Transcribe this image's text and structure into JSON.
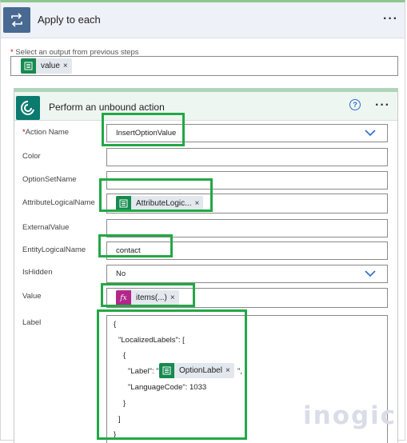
{
  "loop": {
    "title": "Apply to each",
    "more_label": "···",
    "select_label": "Select an output from previous steps",
    "required_mark": "*",
    "token": {
      "label": "value",
      "remove": "×",
      "icon": "dynamics-content-icon"
    }
  },
  "action": {
    "title": "Perform an unbound action",
    "help_label": "?",
    "more_label": "···",
    "required_mark": "*",
    "fields": {
      "action_name": {
        "label": "Action Name",
        "value": "InsertOptionValue"
      },
      "color": {
        "label": "Color",
        "value": ""
      },
      "option_set_name": {
        "label": "OptionSetName",
        "value": ""
      },
      "attribute_logical_name": {
        "label": "AttributeLogicalName",
        "token": "AttributeLogic...",
        "remove": "×"
      },
      "external_value": {
        "label": "ExternalValue",
        "value": ""
      },
      "entity_logical_name": {
        "label": "EntityLogicalName",
        "value": "contact"
      },
      "is_hidden": {
        "label": "IsHidden",
        "value": "No"
      },
      "value": {
        "label": "Value",
        "token": "items(...)",
        "icon_text": "fx",
        "remove": "×"
      },
      "label": {
        "label": "Label",
        "json_lines": {
          "l1": "{",
          "l2": "\"LocalizedLabels\": [",
          "l3": "{",
          "l4_pre": "\"Label\": \"",
          "l4_token": "OptionLabel",
          "l4_remove": "×",
          "l4_post": "\",",
          "l5": "\"LanguageCode\": 1033",
          "l6": "}",
          "l7": "]",
          "l8": "}"
        }
      }
    }
  },
  "watermark": "inogic",
  "colors": {
    "highlight": "#22a845",
    "loop_icon": "#486991",
    "dataverse": "#0b7a6f",
    "token_green": "#168a4f",
    "fx_pink": "#b3278a",
    "link_blue": "#2b6cd4"
  }
}
